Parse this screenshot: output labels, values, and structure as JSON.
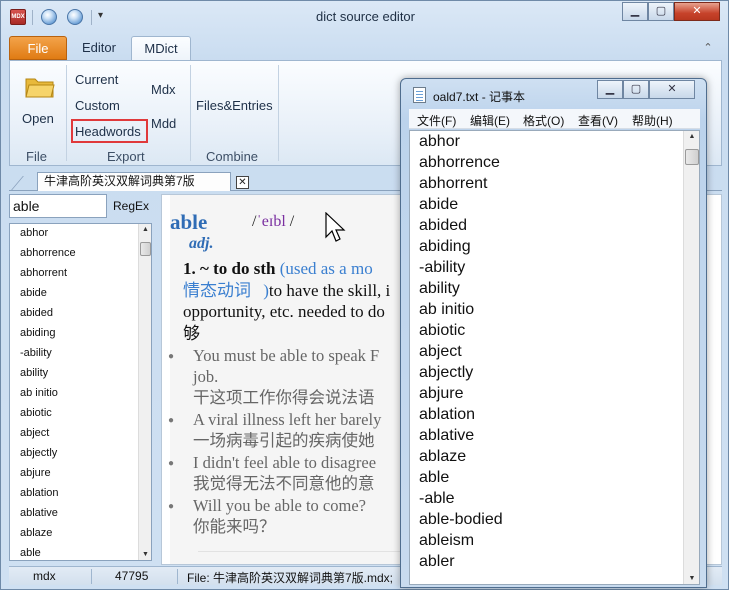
{
  "window": {
    "title": "dict source editor",
    "app_icon_text": "MDX"
  },
  "ribbon": {
    "tabs": [
      "File",
      "Editor",
      "MDict"
    ],
    "groups": {
      "file": {
        "label": "File",
        "open": "Open"
      },
      "export": {
        "label": "Export",
        "current": "Current",
        "custom": "Custom",
        "headwords": "Headwords",
        "mdx": "Mdx",
        "mdd": "Mdd"
      },
      "combine": {
        "label": "Combine",
        "files_entries": "Files&Entries"
      }
    }
  },
  "doc_tab": {
    "label": "牛津高阶英汉双解词典第7版",
    "close": "✕"
  },
  "search": {
    "value": "able",
    "regex_label": "RegEx"
  },
  "headwords": [
    "abhor",
    "abhorrence",
    "abhorrent",
    "abide",
    "abided",
    "abiding",
    "-ability",
    "ability",
    "ab initio",
    "abiotic",
    "abject",
    "abjectly",
    "abjure",
    "ablation",
    "ablative",
    "ablaze",
    "able"
  ],
  "entry": {
    "headword": "able",
    "pron_open": "/",
    "pron_ipa": "ˈeɪbl",
    "pron_close": "/",
    "pos": "adj.",
    "sense_num": "1.",
    "sense_pattern": "~ to do sth",
    "sense_note": "(used as a mo",
    "sense_note_zh": "情态动词",
    "sense_note_close": ")",
    "sense_def": "to have the skill, i",
    "sense_def2": "opportunity, etc. needed to do",
    "sense_def_zh": "够",
    "examples": [
      {
        "en": "You must be able to speak F",
        "en2": "job.",
        "zh": "干这项工作你得会说法语"
      },
      {
        "en": "A viral illness left her barely",
        "zh": "一场病毒引起的疾病使她"
      },
      {
        "en": "I didn't feel able to disagree",
        "zh": "我觉得无法不同意他的意"
      },
      {
        "en": "Will you be able to come?",
        "zh": "你能来吗？"
      }
    ]
  },
  "status": {
    "format": "mdx",
    "count": "47795",
    "file": "File: 牛津高阶英汉双解词典第7版.mdx;"
  },
  "notepad": {
    "title": "oald7.txt - 记事本",
    "menus": [
      "文件(F)",
      "编辑(E)",
      "格式(O)",
      "查看(V)",
      "帮助(H)"
    ],
    "lines": [
      "abhor",
      "abhorrence",
      "abhorrent",
      "abide",
      "abided",
      "abiding",
      "-ability",
      "ability",
      "ab initio",
      "abiotic",
      "abject",
      "abjectly",
      "abjure",
      "ablation",
      "ablative",
      "ablaze",
      "able",
      "-able",
      "able-bodied",
      "ableism",
      "abler"
    ]
  },
  "colors": {
    "accent": "#2f6cb5",
    "file_tab": "#e07b13",
    "highlight_box": "#e0393b"
  }
}
